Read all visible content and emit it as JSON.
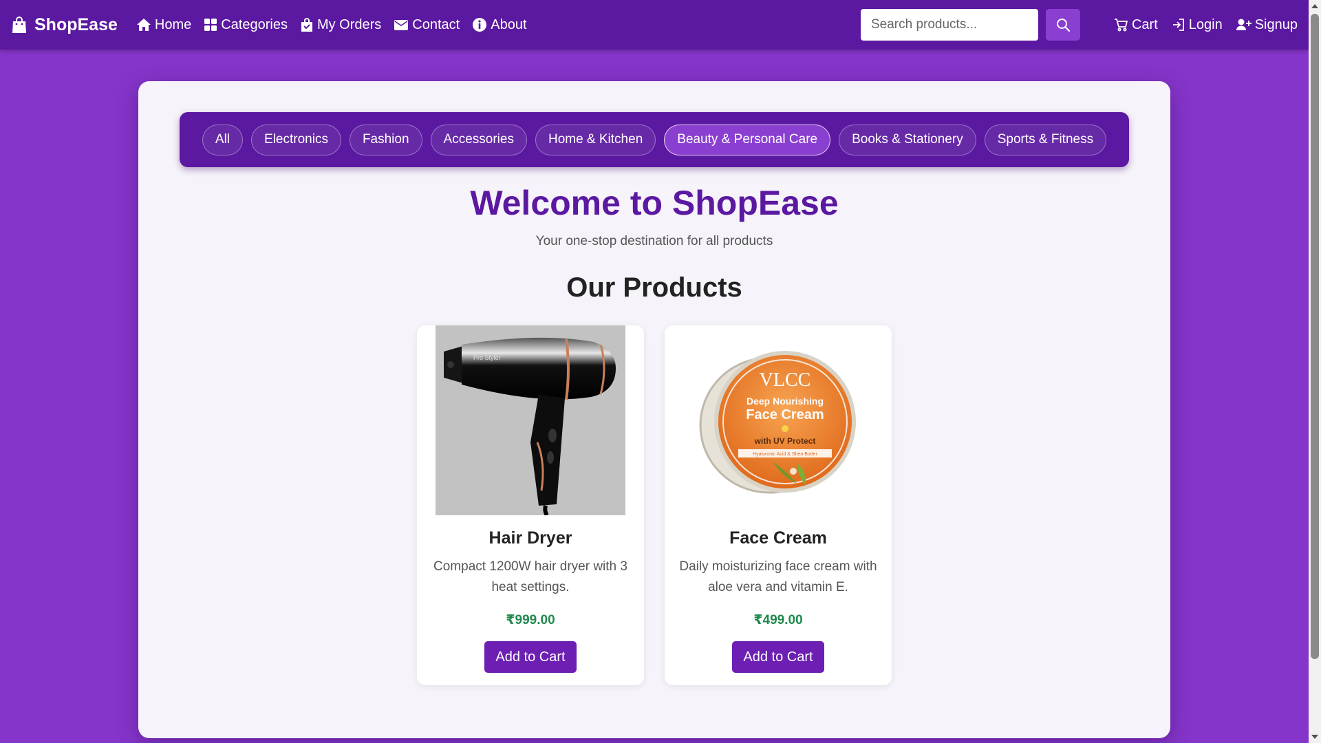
{
  "brand": {
    "name": "ShopEase",
    "icon": "shopping-bag-icon"
  },
  "nav": {
    "links": [
      {
        "label": "Home",
        "icon": "home-icon"
      },
      {
        "label": "Categories",
        "icon": "grid-icon"
      },
      {
        "label": "My Orders",
        "icon": "order-bag-icon"
      },
      {
        "label": "Contact",
        "icon": "envelope-icon"
      },
      {
        "label": "About",
        "icon": "info-icon"
      }
    ],
    "search_placeholder": "Search products...",
    "right_links": [
      {
        "label": "Cart",
        "icon": "cart-icon"
      },
      {
        "label": "Login",
        "icon": "login-icon"
      },
      {
        "label": "Signup",
        "icon": "user-plus-icon"
      }
    ]
  },
  "categories": {
    "items": [
      "All",
      "Electronics",
      "Fashion",
      "Accessories",
      "Home & Kitchen",
      "Beauty & Personal Care",
      "Books & Stationery",
      "Sports & Fitness"
    ],
    "active": "Beauty & Personal Care"
  },
  "hero": {
    "title": "Welcome to ShopEase",
    "tagline": "Your one-stop destination for all products"
  },
  "products": {
    "section_title": "Our Products",
    "items": [
      {
        "name": "Hair Dryer",
        "description": "Compact 1200W hair dryer with 3 heat settings.",
        "price": "₹999.00",
        "button": "Add to Cart",
        "image_text": "Pro Styler"
      },
      {
        "name": "Face Cream",
        "description": "Daily moisturizing face cream with aloe vera and vitamin E.",
        "price": "₹499.00",
        "button": "Add to Cart",
        "image_text": {
          "brand": "VLCC",
          "line1": "Deep Nourishing",
          "line2": "Face Cream",
          "line3": "with UV Protect",
          "line4": "Hyaluronic Acid & Shea Butter"
        }
      }
    ]
  },
  "colors": {
    "page_bg": "#8535c9",
    "navbar": "#5b18a0",
    "accent": "#8a3fd1",
    "button": "#6c1fb2",
    "price": "#1f8a4c"
  }
}
